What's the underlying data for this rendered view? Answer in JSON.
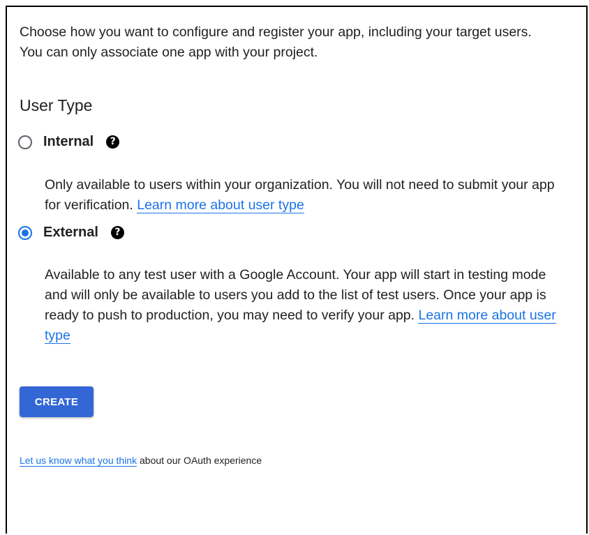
{
  "intro": "Choose how you want to configure and register your app, including your target users. You can only associate one app with your project.",
  "user_type": {
    "title": "User Type",
    "options": [
      {
        "label": "Internal",
        "selected": false,
        "description": "Only available to users within your organization. You will not need to submit your app for verification.",
        "link": "Learn more about user type"
      },
      {
        "label": "External",
        "selected": true,
        "description": "Available to any test user with a Google Account. Your app will start in testing mode and will only be available to users you add to the list of test users. Once your app is ready to push to production, you may need to verify your app.",
        "link": "Learn more about user type"
      }
    ]
  },
  "create_button": "CREATE",
  "feedback": {
    "link": "Let us know what you think",
    "text": "about our OAuth experience"
  },
  "icons": {
    "help": "help-circle-icon"
  },
  "colors": {
    "accent": "#1a73e8",
    "button": "#3367d6"
  }
}
